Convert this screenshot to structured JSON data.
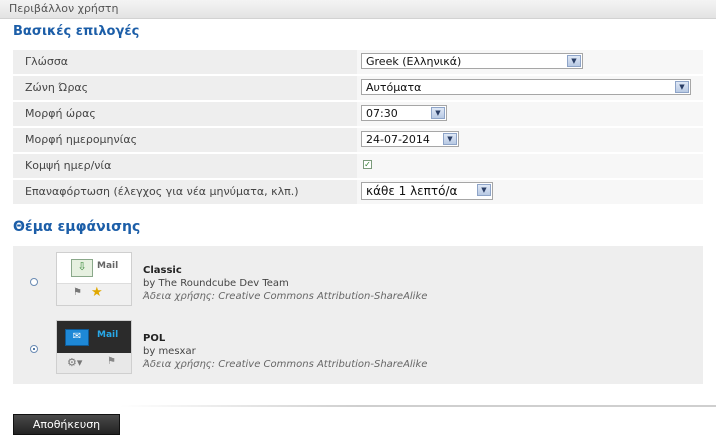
{
  "window": {
    "title": "Περιβάλλον χρήστη"
  },
  "main_options": {
    "heading": "Βασικές επιλογές",
    "rows": [
      {
        "label": "Γλώσσα",
        "value": "Greek (Ελληνικά)"
      },
      {
        "label": "Ζώνη Ώρας",
        "value": "Αυτόματα"
      },
      {
        "label": "Μορφή ώρας",
        "value": "07:30"
      },
      {
        "label": "Μορφή ημερομηνίας",
        "value": "24-07-2014"
      },
      {
        "label": "Κομψή ημερ/νία",
        "checked": true
      },
      {
        "label": "Επαναφόρτωση (έλεγχος για νέα μηνύματα, κλπ.)",
        "value": "κάθε 1 λεπτό/α"
      }
    ]
  },
  "skin": {
    "heading": "Θέμα εμφάνισης",
    "themes": [
      {
        "name": "Classic",
        "author": "by The Roundcube Dev Team",
        "license": "Άδεια χρήσης: Creative Commons Attribution-ShareAlike",
        "selected": false,
        "thumb_label": "Mail"
      },
      {
        "name": "POL",
        "author": "by mesxar",
        "license": "Άδεια χρήσης: Creative Commons Attribution-ShareAlike",
        "selected": true,
        "thumb_label": "Mail"
      }
    ]
  },
  "actions": {
    "save_label": "Αποθήκευση"
  },
  "colors": {
    "heading": "#1c5ea8",
    "row_bg": "#eeeeee",
    "button_bg": "#222222"
  }
}
